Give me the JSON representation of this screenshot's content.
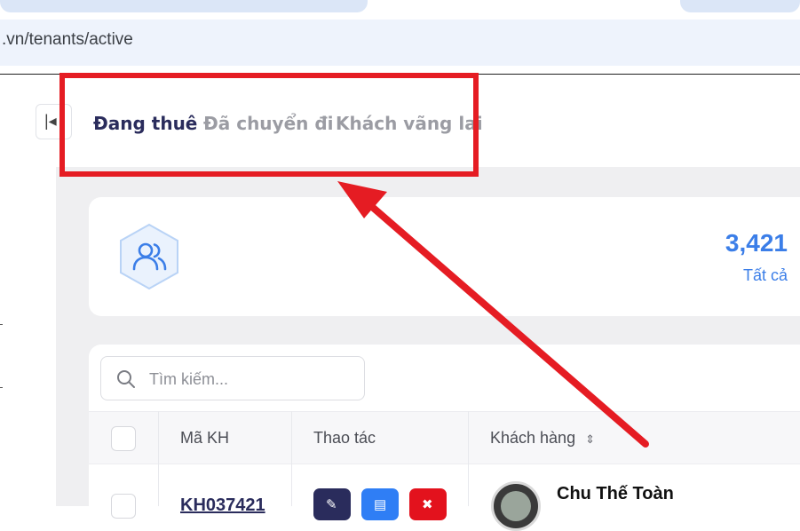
{
  "browser": {
    "url_text": ".vn/tenants/active"
  },
  "tabs": [
    {
      "label": "Đang thuê",
      "active": true
    },
    {
      "label": "Đã chuyển đi",
      "active": false
    },
    {
      "label": "Khách vãng lai",
      "active": false
    }
  ],
  "stats": {
    "value": "3,421",
    "label": "Tất cả",
    "icon": "users-icon"
  },
  "search": {
    "placeholder": "Tìm kiếm..."
  },
  "table": {
    "columns": [
      "Mã KH",
      "Thao tác",
      "Khách hàng"
    ],
    "rows": [
      {
        "code": "KH037421",
        "customer": "Chu Thế Toàn"
      }
    ]
  },
  "colors": {
    "accent": "#3b7ee8",
    "active_tab": "#2a2c5c",
    "annotation": "#e51c23"
  }
}
